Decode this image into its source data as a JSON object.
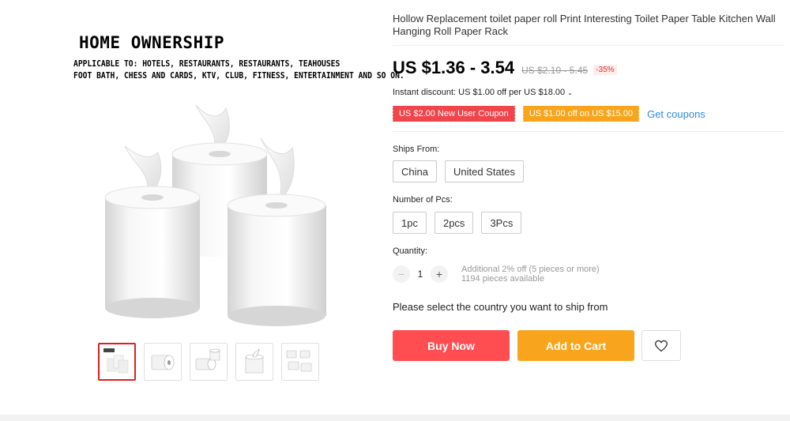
{
  "product": {
    "title": "Hollow Replacement toilet paper roll Print Interesting Toilet Paper Table Kitchen Wall Hanging Roll Paper Rack",
    "image": {
      "heading": "HOME OWNERSHIP",
      "line1": "APPLICABLE TO: HOTELS, RESTAURANTS, RESTAURANTS, TEAHOUSES",
      "line2": "FOOT BATH, CHESS AND CARDS, KTV, CLUB, FITNESS, ENTERTAINMENT AND SO ON."
    },
    "thumbnail_count": 5
  },
  "price": {
    "current": "US $1.36 - 3.54",
    "original": "US $2.10 - 5.45",
    "discount": "-35%"
  },
  "instant_discount": "Instant discount: US $1.00 off per US $18.00",
  "coupons": {
    "new_user": "US $2.00 New User Coupon",
    "off": "US $1.00 off on US $15.00",
    "get_link": "Get coupons"
  },
  "ships_from": {
    "label": "Ships From:",
    "options": [
      "China",
      "United States"
    ]
  },
  "pieces": {
    "label": "Number of Pcs:",
    "options": [
      "1pc",
      "2pcs",
      "3Pcs"
    ]
  },
  "quantity": {
    "label": "Quantity:",
    "value": "1",
    "minus": "−",
    "plus": "+",
    "note_discount": "Additional 2% off (5 pieces or more)",
    "note_available": "1194 pieces available"
  },
  "ship_message": "Please select the country you want to ship from",
  "actions": {
    "buy_now": "Buy Now",
    "add_to_cart": "Add to Cart"
  },
  "colors": {
    "buy": "#ff4d52",
    "cart": "#f8a51d",
    "coupon_red": "#f0454b",
    "coupon_orange": "#f8a51d",
    "link": "#2f8ae5",
    "discount": "#e62e2e"
  },
  "icons": {
    "wishlist": "heart-icon",
    "chevron": "chevron-down-icon"
  }
}
